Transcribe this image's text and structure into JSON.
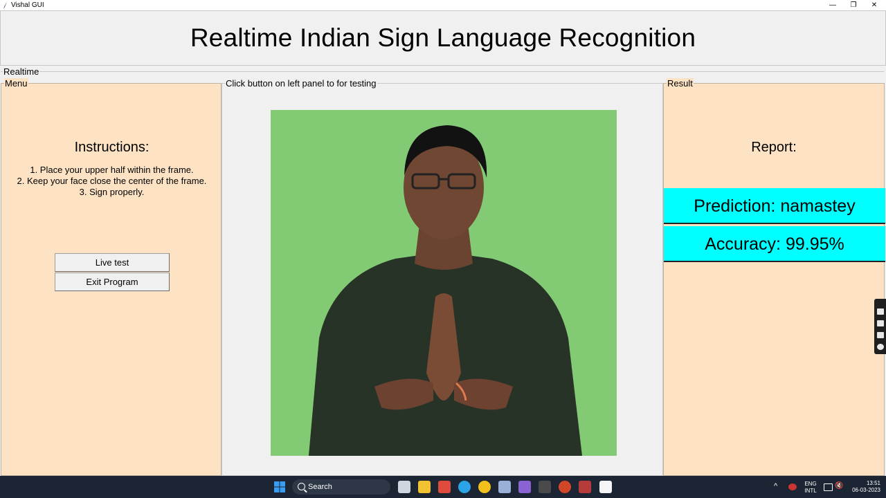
{
  "window": {
    "title": "Vishal GUI",
    "minimize_glyph": "—",
    "maximize_glyph": "❐",
    "close_glyph": "✕"
  },
  "header": {
    "title": "Realtime Indian Sign Language Recognition"
  },
  "realtime_group": {
    "label": "Realtime"
  },
  "menu": {
    "label": "Menu",
    "instructions_title": "Instructions:",
    "instructions": [
      "1. Place your upper half within the frame.",
      "2. Keep your face close the center of the frame.",
      "3. Sign properly."
    ],
    "live_test_label": "Live test",
    "exit_label": "Exit Program"
  },
  "center": {
    "label": "Click button on left panel to for testing"
  },
  "result": {
    "label": "Result",
    "report_title": "Report:",
    "prediction": "Prediction: namastey",
    "accuracy": "Accuracy: 99.95%"
  },
  "taskbar": {
    "search_placeholder": "Search",
    "lang_top": "ENG",
    "lang_bottom": "INTL",
    "time": "13:51",
    "date": "06-03-2023",
    "tray_arrow": "^"
  },
  "colors": {
    "panel_bg": "#fde3c4",
    "result_highlight": "#00ffff",
    "green_screen": "#86cf77",
    "taskbar_bg": "#1c2533"
  }
}
